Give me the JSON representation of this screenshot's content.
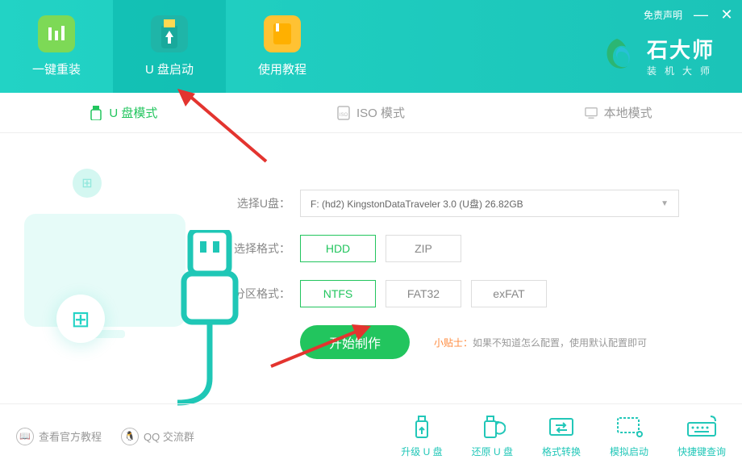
{
  "header": {
    "nav": [
      {
        "label": "一键重装"
      },
      {
        "label": "U 盘启动"
      },
      {
        "label": "使用教程"
      }
    ],
    "disclaimer": "免责声明",
    "brand_title": "石大师",
    "brand_sub": "装机大师"
  },
  "tabs": [
    {
      "label": "U 盘模式",
      "active": true
    },
    {
      "label": "ISO 模式",
      "active": false
    },
    {
      "label": "本地模式",
      "active": false
    }
  ],
  "form": {
    "disk_label": "选择U盘：",
    "disk_value": "F: (hd2) KingstonDataTraveler 3.0 (U盘) 26.82GB",
    "format_label": "选择格式：",
    "format_options": [
      "HDD",
      "ZIP"
    ],
    "format_selected": "HDD",
    "partition_label": "分区格式：",
    "partition_options": [
      "NTFS",
      "FAT32",
      "exFAT"
    ],
    "partition_selected": "NTFS",
    "primary_button": "开始制作",
    "tip_label": "小贴士：",
    "tip_text": "如果不知道怎么配置，使用默认配置即可"
  },
  "footer": {
    "links": [
      {
        "label": "查看官方教程"
      },
      {
        "label": "QQ 交流群"
      }
    ],
    "tools": [
      {
        "label": "升级 U 盘"
      },
      {
        "label": "还原 U 盘"
      },
      {
        "label": "格式转换"
      },
      {
        "label": "模拟启动"
      },
      {
        "label": "快捷键查询"
      }
    ]
  }
}
